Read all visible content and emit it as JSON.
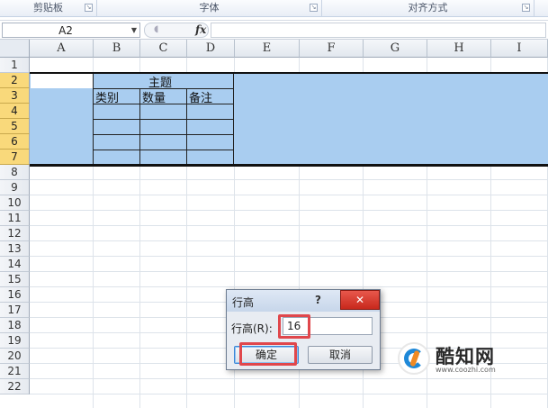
{
  "ribbon": {
    "groups": [
      {
        "label": "剪贴板",
        "launcher": "dialog-launcher-icon"
      },
      {
        "label": "字体",
        "launcher": "dialog-launcher-icon"
      },
      {
        "label": "对齐方式",
        "launcher": "dialog-launcher-icon"
      }
    ]
  },
  "formula_bar": {
    "name_box": "A2",
    "fx_label": "fx",
    "formula": ""
  },
  "columns": [
    "A",
    "B",
    "C",
    "D",
    "E",
    "F",
    "G",
    "H",
    "I"
  ],
  "rows": [
    "1",
    "2",
    "3",
    "4",
    "5",
    "6",
    "7",
    "8",
    "9",
    "10",
    "11",
    "12",
    "13",
    "14",
    "15",
    "16",
    "17",
    "18",
    "19",
    "20",
    "21",
    "22"
  ],
  "selected_rows": [
    "2",
    "3",
    "4",
    "5",
    "6",
    "7"
  ],
  "cells": {
    "title": "主题",
    "header_category": "类别",
    "header_quantity": "数量",
    "header_note": "备注"
  },
  "dialog": {
    "title": "行高",
    "help": "?",
    "close": "✕",
    "label": "行高(R):",
    "value": "16",
    "ok": "确定",
    "cancel": "取消"
  },
  "watermark": {
    "name": "酷知网",
    "url": "www.coozhi.com"
  },
  "colors": {
    "selection": "#a9cdf0",
    "selected_row_header": "#f9d97b",
    "highlight": "#e0474c",
    "close_button": "#d0382c"
  }
}
